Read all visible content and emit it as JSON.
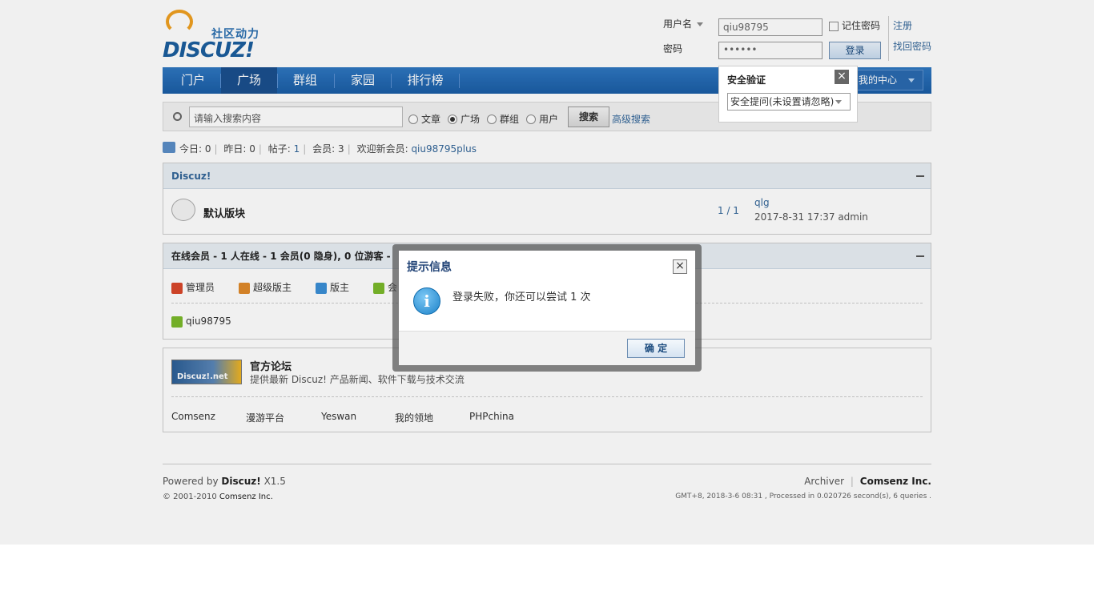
{
  "logo": {
    "sub": "社区动力",
    "text": "DISCUZ!"
  },
  "login": {
    "username_label": "用户名",
    "username_value": "qiu98795",
    "password_label": "密码",
    "password_value": "••••••",
    "remember_label": "记住密码",
    "register_link": "注册",
    "forgot_link": "找回密码",
    "login_button": "登录"
  },
  "nav": {
    "items": [
      {
        "label": "门户"
      },
      {
        "label": "广场"
      },
      {
        "label": "群组"
      },
      {
        "label": "家园"
      },
      {
        "label": "排行榜"
      }
    ],
    "active": "广场",
    "my_center": "我的中心"
  },
  "security": {
    "title": "安全验证",
    "select_value": "安全提问(未设置请忽略)"
  },
  "search": {
    "placeholder": "请输入搜索内容",
    "options": [
      "文章",
      "广场",
      "群组",
      "用户"
    ],
    "selected": "广场",
    "button": "搜索",
    "advanced": "高级搜索"
  },
  "stats": {
    "today_label": "今日:",
    "today": "0",
    "yesterday_label": "昨日:",
    "yesterday": "0",
    "posts_label": "帖子:",
    "posts": "1",
    "members_label": "会员:",
    "members": "3",
    "welcome_label": "欢迎新会员:",
    "newest_member": "qiu98795plus"
  },
  "category": {
    "title": "Discuz!",
    "forum_name": "默认版块",
    "counts": "1 / 1",
    "last_title": "qlg",
    "last_info": "2017-8-31 17:37 admin"
  },
  "online": {
    "title": "在线会员 - 1 人在线 - 1 会员(0 隐身), 0 位游客 -",
    "groups": [
      {
        "label": "管理员",
        "color": "#d9482b"
      },
      {
        "label": "超级版主",
        "color": "#e08a2a"
      },
      {
        "label": "版主",
        "color": "#3b8fd6"
      },
      {
        "label": "会",
        "color": "#7bb92b"
      }
    ],
    "users": [
      {
        "name": "qiu98795",
        "color": "#7bb92b"
      }
    ]
  },
  "links": {
    "logo_text": "Discuz!.net",
    "title": "官方论坛",
    "desc": "提供最新 Discuz! 产品新闻、软件下载与技术交流",
    "items": [
      "Comsenz",
      "漫游平台",
      "Yeswan",
      "我的领地",
      "PHPchina"
    ]
  },
  "footer": {
    "powered_prefix": "Powered by",
    "product": "Discuz!",
    "version": "X1.5",
    "copyright": "© 2001-2010",
    "copyright_company": "Comsenz Inc.",
    "archiver": "Archiver",
    "company": "Comsenz Inc.",
    "stats_line": "GMT+8, 2018-3-6 08:31 , Processed in 0.020726 second(s), 6 queries ."
  },
  "dialog": {
    "title": "提示信息",
    "message": "登录失败，你还可以尝试 1 次",
    "ok_button": "确 定"
  }
}
